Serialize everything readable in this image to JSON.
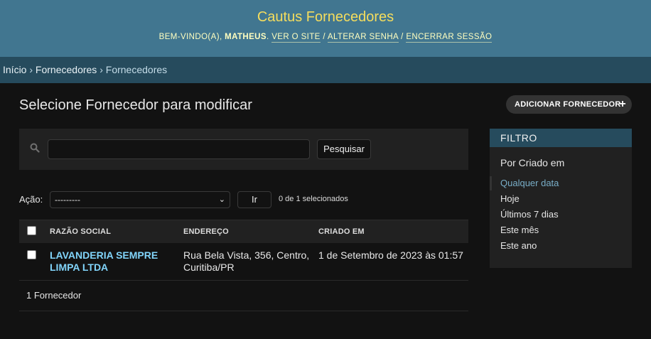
{
  "header": {
    "site_title": "Cautus Fornecedores",
    "welcome": "BEM-VINDO(A),",
    "username": "MATHEUS",
    "period": ".",
    "links": {
      "view_site": "VER O SITE",
      "change_password": "ALTERAR SENHA",
      "logout": "ENCERRAR SESSÃO"
    },
    "separator": "/"
  },
  "breadcrumbs": {
    "home": "Início",
    "app": "Fornecedores",
    "current": "Fornecedores",
    "separator": "›"
  },
  "page": {
    "title": "Selecione Fornecedor para modificar",
    "add_button": "ADICIONAR FORNECEDOR"
  },
  "search": {
    "value": "",
    "button": "Pesquisar"
  },
  "actions": {
    "label": "Ação:",
    "selected": "---------",
    "go_button": "Ir",
    "counter": "0 de 1 selecionados"
  },
  "table": {
    "columns": [
      "RAZÃO SOCIAL",
      "ENDEREÇO",
      "CRIADO EM"
    ],
    "rows": [
      {
        "name_line1": "LAVANDERIA SEMPRE",
        "name_line2": "LIMPA LTDA",
        "address_line1": "Rua Bela Vista, 356, Centro,",
        "address_line2": "Curitiba/PR",
        "created": "1 de Setembro de 2023 às 01:57"
      }
    ],
    "result_count": "1 Fornecedor"
  },
  "filter": {
    "title": "FILTRO",
    "heading": "Por Criado em",
    "options": [
      "Qualquer data",
      "Hoje",
      "Últimos 7 dias",
      "Este mês",
      "Este ano"
    ],
    "selected_index": 0
  },
  "colors": {
    "header_bg": "#417690",
    "breadcrumb_bg": "#264b5d",
    "site_title": "#f5dd5d",
    "link": "#81d4fa",
    "body_bg": "#121212"
  }
}
